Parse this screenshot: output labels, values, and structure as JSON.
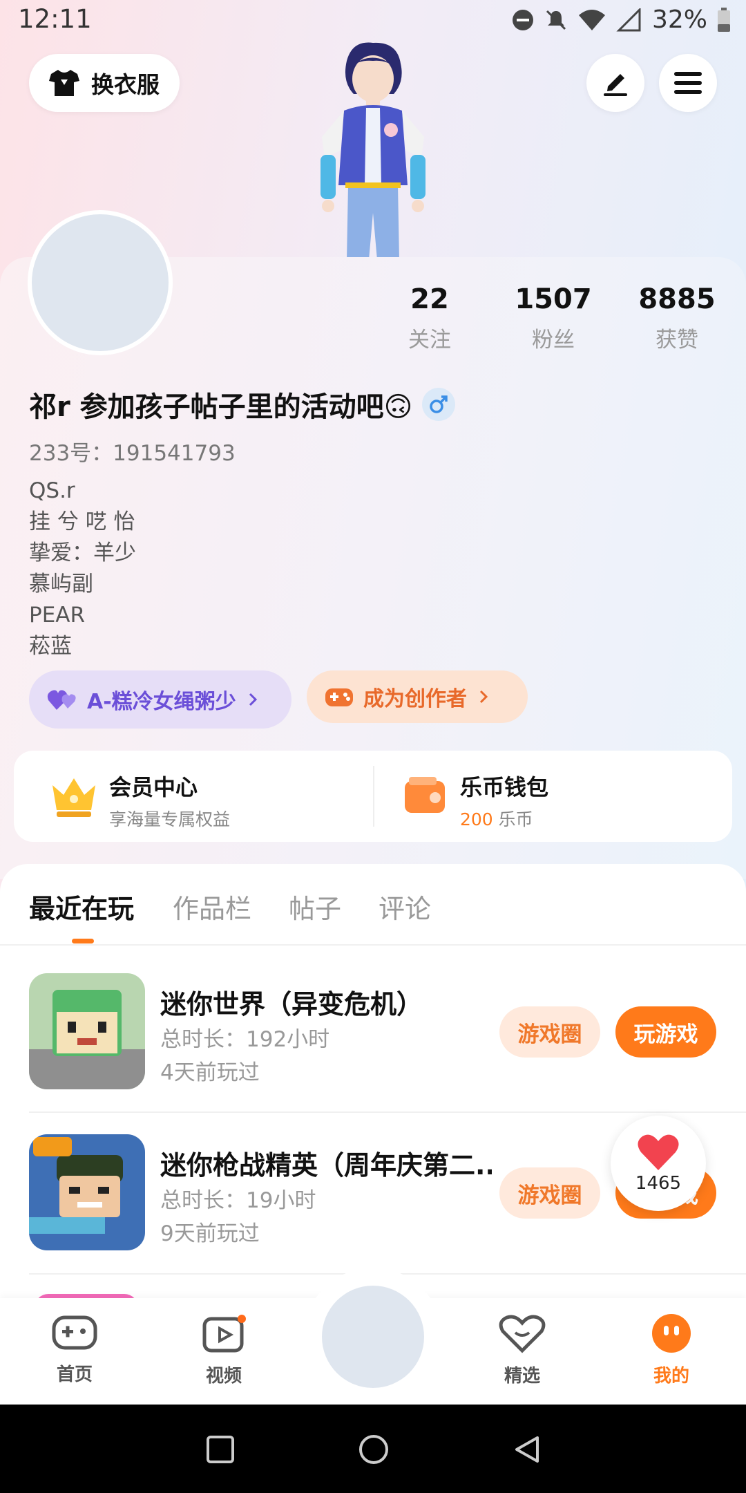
{
  "status_bar": {
    "time": "12:11",
    "battery": "32%"
  },
  "header": {
    "outfit_label": "换衣服"
  },
  "profile": {
    "stats": [
      {
        "num": "22",
        "label": "关注"
      },
      {
        "num": "1507",
        "label": "粉丝"
      },
      {
        "num": "8885",
        "label": "获赞"
      }
    ],
    "username": "祁r 参加孩子帖子里的活动吧🙃",
    "uid": "233号：191541793",
    "bio": [
      "QS.r",
      "挂 兮 呓 怡",
      "挚爱：羊少",
      "慕屿副",
      "PEAR",
      "菘蓝"
    ],
    "tags": [
      {
        "label": "A-糕冷女绳粥少"
      },
      {
        "label": "成为创作者"
      }
    ]
  },
  "vip": {
    "title": "会员中心",
    "sub": "享海量专属权益",
    "wallet_title": "乐币钱包",
    "wallet_amount": "200",
    "wallet_unit": "乐币"
  },
  "tabs": [
    "最近在玩",
    "作品栏",
    "帖子",
    "评论"
  ],
  "games": [
    {
      "title": "迷你世界（异变危机）",
      "duration": "总时长：192小时",
      "last": "4天前玩过",
      "circle_btn": "游戏圈",
      "play_btn": "玩游戏"
    },
    {
      "title": "迷你枪战精英（周年庆第二...",
      "duration": "总时长：19小时",
      "last": "9天前玩过",
      "circle_btn": "游戏圈",
      "play_btn": "戏"
    }
  ],
  "like_count": "1465",
  "bottom_nav": [
    {
      "label": "首页"
    },
    {
      "label": "视频"
    },
    {
      "label": "精选"
    },
    {
      "label": "我的"
    }
  ],
  "colors": {
    "accent": "#ff7a1a",
    "purple_tag": "#6b4fd8"
  },
  "icons": [
    "shirt-icon",
    "edit-icon",
    "menu-icon",
    "gender-male-icon",
    "heart-icon",
    "gamepad-icon",
    "crown-icon",
    "wallet-icon",
    "home-icon",
    "video-icon",
    "featured-icon",
    "mine-icon"
  ]
}
